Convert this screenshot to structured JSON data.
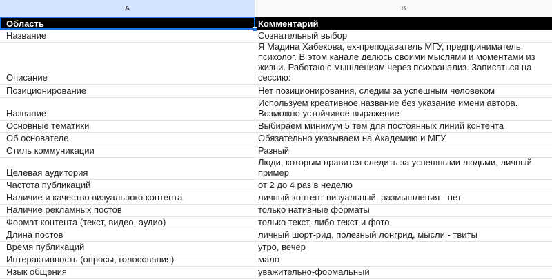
{
  "columns": {
    "a": "A",
    "b": "B"
  },
  "header": {
    "a": "Область",
    "b": "Комментарий"
  },
  "rows": [
    {
      "a": "Название",
      "b": "Сознательный выбор"
    },
    {
      "a": "Описание",
      "b": "Я Мадина Хабекова, ex-преподаватель МГУ, предприниматель, психолог. В этом канале делюсь своими мыслями и моментами из жизни. Работаю с мышлениям через психоанализ. Записаться на сессию:"
    },
    {
      "a": "Позиционирование",
      "b": "Нет позиционирования, следим за успешным человеком"
    },
    {
      "a": "Название",
      "b": "Используем креативное название без указание имени автора. Возможно устойчивое выражение"
    },
    {
      "a": "Основные тематики",
      "b": "Выбираем минимум 5 тем для постоянных линий контента"
    },
    {
      "a": "Об основателе",
      "b": "Обязательно указываем на Академию и МГУ"
    },
    {
      "a": "Стиль коммуникации",
      "b": "Разный"
    },
    {
      "a": "Целевая аудитория",
      "b": "Люди, которым нравится следить за успешными людьми, личный пример"
    },
    {
      "a": "Частота публикаций",
      "b": "от 2 до 4 раз в неделю"
    },
    {
      "a": "Наличие и качество визуального контента",
      "b": "личный контент визуальный, размышления - нет"
    },
    {
      "a": "Наличие рекламных постов",
      "b": "только нативные форматы"
    },
    {
      "a": "Формат контента (текст, видео, аудио)",
      "b": "только текст, либо текст и фото"
    },
    {
      "a": "Длина постов",
      "b": "личный шорт-рид, полезный лонгрид, мысли - твиты"
    },
    {
      "a": "Время публикаций",
      "b": "утро, вечер"
    },
    {
      "a": "Интерактивность (опросы, голосования)",
      "b": "мало"
    },
    {
      "a": "Язык общения",
      "b": "уважительно-формальный"
    }
  ]
}
